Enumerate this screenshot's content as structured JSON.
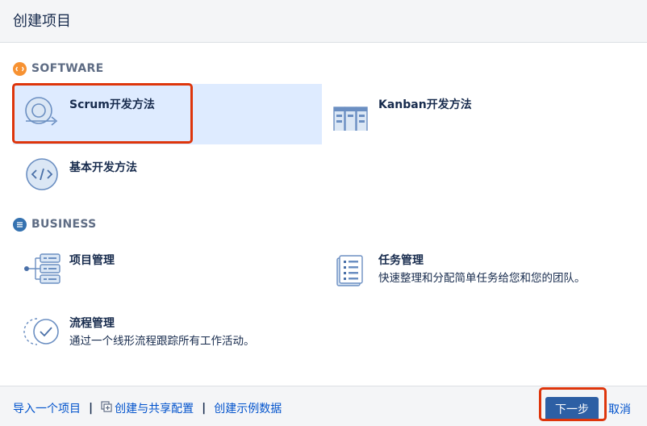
{
  "dialog": {
    "title": "创建项目"
  },
  "sections": {
    "software": {
      "label": "SOFTWARE",
      "color": "#f79232"
    },
    "business": {
      "label": "BUSINESS",
      "color": "#3572b0"
    }
  },
  "items": {
    "scrum": {
      "title": "Scrum开发方法",
      "icon": "scrum-cycle-icon"
    },
    "kanban": {
      "title": "Kanban开发方法",
      "icon": "kanban-board-icon"
    },
    "basic": {
      "title": "基本开发方法",
      "icon": "code-icon"
    },
    "project_mgmt": {
      "title": "项目管理",
      "icon": "hierarchy-icon"
    },
    "task_mgmt": {
      "title": "任务管理",
      "desc": "快速整理和分配简单任务给您和您的团队。",
      "icon": "checklist-icon"
    },
    "process_mgmt": {
      "title": "流程管理",
      "desc": "通过一个线形流程跟踪所有工作活动。",
      "icon": "process-check-icon"
    }
  },
  "footer": {
    "import_label": "导入一个项目",
    "shared_config_label": "创建与共享配置",
    "sample_data_label": "创建示例数据",
    "next_label": "下一步",
    "cancel_label": "取消"
  },
  "colors": {
    "accent": "#2d5fa4",
    "selected_bg": "#deebff",
    "highlight": "#de350b"
  }
}
